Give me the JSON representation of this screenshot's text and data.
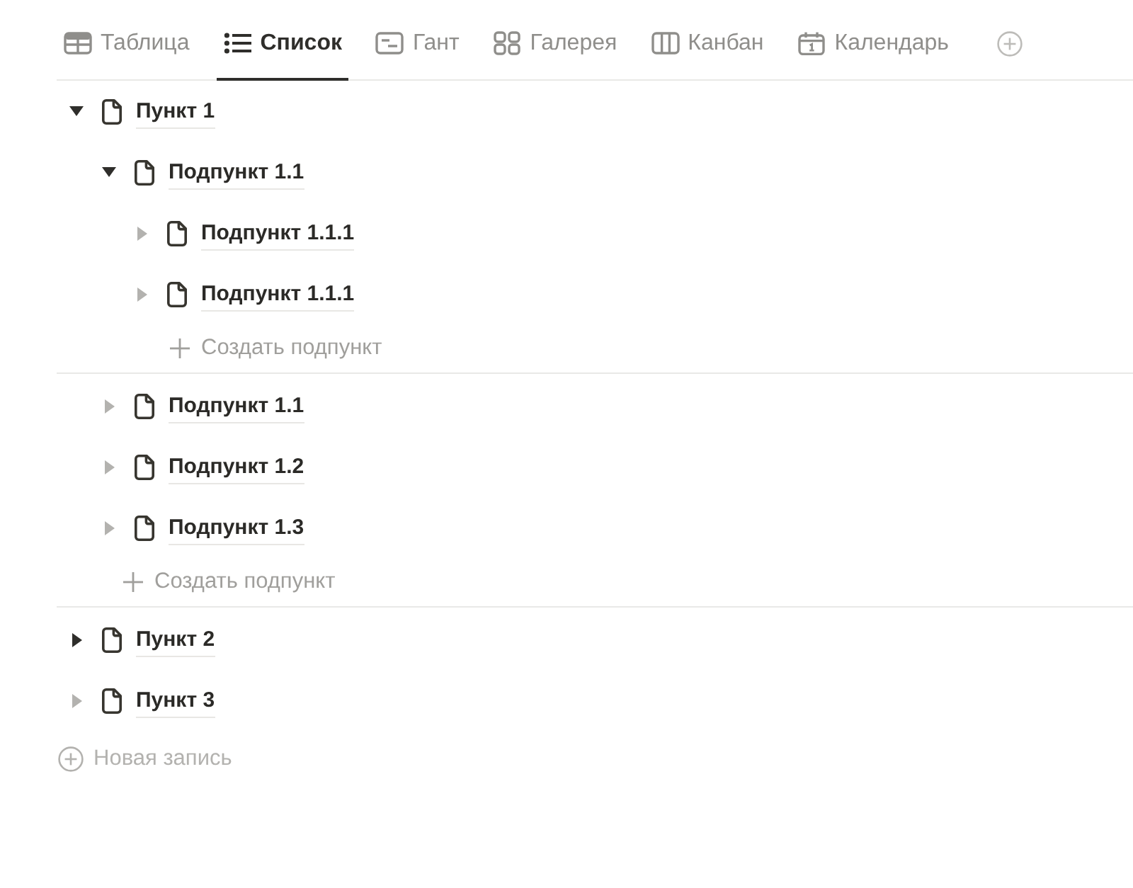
{
  "tabs": [
    {
      "kind": "table",
      "label": "Таблица",
      "selected": false
    },
    {
      "kind": "list",
      "label": "Список",
      "selected": true
    },
    {
      "kind": "gantt",
      "label": "Гант",
      "selected": false
    },
    {
      "kind": "gallery",
      "label": "Галерея",
      "selected": false
    },
    {
      "kind": "board",
      "label": "Канбан",
      "selected": false
    },
    {
      "kind": "calendar",
      "label": "Календарь",
      "selected": false
    }
  ],
  "items": [
    {
      "title": "Пункт 1",
      "expanded": true,
      "has_children": true,
      "add_label": "Создать подпункт",
      "children": [
        {
          "title": "Подпункт 1.1",
          "expanded": true,
          "has_children": true,
          "add_label": "Создать подпункт",
          "children": [
            {
              "title": "Подпункт 1.1.1",
              "expanded": false,
              "has_children": false
            },
            {
              "title": "Подпункт 1.1.1",
              "expanded": false,
              "has_children": false
            }
          ]
        },
        {
          "title": "Подпункт 1.1",
          "expanded": false,
          "has_children": false
        },
        {
          "title": "Подпункт 1.2",
          "expanded": false,
          "has_children": false
        },
        {
          "title": "Подпункт 1.3",
          "expanded": false,
          "has_children": false
        }
      ]
    },
    {
      "title": "Пункт 2",
      "expanded": false,
      "has_children": true
    },
    {
      "title": "Пункт 3",
      "expanded": false,
      "has_children": false
    }
  ],
  "new_record": {
    "label": "Новая запись"
  }
}
